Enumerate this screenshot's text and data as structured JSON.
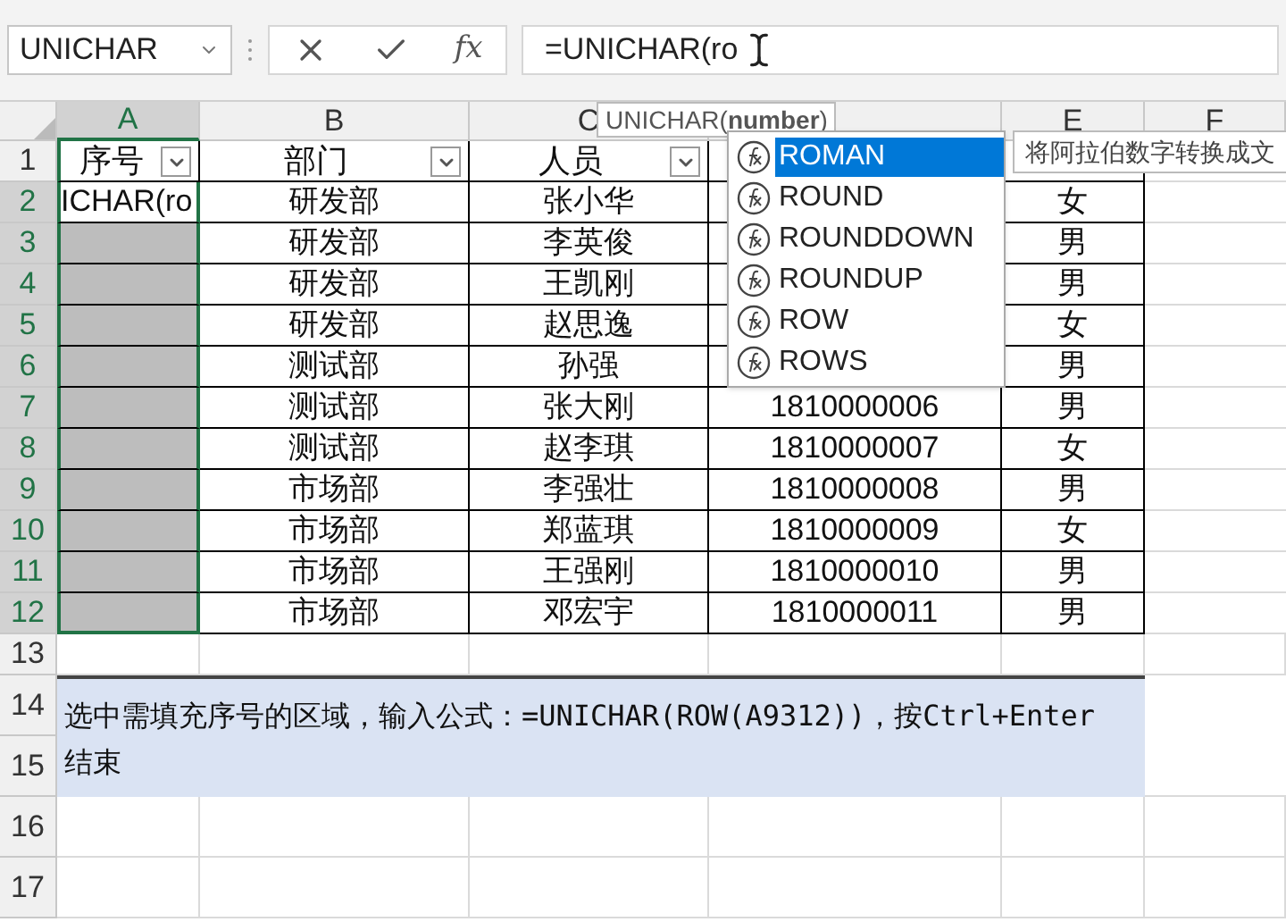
{
  "name_box": {
    "value": "UNICHAR"
  },
  "formula_bar": {
    "fx_label": "fx",
    "value": "=UNICHAR(ro"
  },
  "columns": [
    {
      "label": "A",
      "selected": true
    },
    {
      "label": "B",
      "selected": false
    },
    {
      "label": "C",
      "selected": false
    },
    {
      "selected": false
    },
    {
      "label": "E",
      "selected": false
    },
    {
      "label": "F",
      "selected": false
    }
  ],
  "rows": [
    {
      "kind": "header",
      "number": "1",
      "selected": false,
      "cells": [
        {
          "text": "序号",
          "filter": true
        },
        {
          "text": "部门",
          "filter": true
        },
        {
          "text": "人员",
          "filter": true
        }
      ]
    },
    {
      "kind": "data",
      "number": "2",
      "selected": true,
      "a": "ICHAR(ro",
      "dept": "研发部",
      "person": "张小华",
      "gender": "女"
    },
    {
      "kind": "data",
      "number": "3",
      "selected": true,
      "dept": "研发部",
      "person": "李英俊",
      "gender": "男"
    },
    {
      "kind": "data",
      "number": "4",
      "selected": true,
      "dept": "研发部",
      "person": "王凯刚",
      "gender": "男"
    },
    {
      "kind": "data",
      "number": "5",
      "selected": true,
      "dept": "研发部",
      "person": "赵思逸",
      "gender": "女"
    },
    {
      "kind": "data",
      "number": "6",
      "selected": true,
      "dept": "测试部",
      "person": "孙强",
      "gender": "男"
    },
    {
      "kind": "data",
      "number": "7",
      "selected": true,
      "dept": "测试部",
      "person": "张大刚",
      "phone": "1810000006",
      "gender": "男"
    },
    {
      "kind": "data",
      "number": "8",
      "selected": true,
      "dept": "测试部",
      "person": "赵李琪",
      "phone": "1810000007",
      "gender": "女"
    },
    {
      "kind": "data",
      "number": "9",
      "selected": true,
      "dept": "市场部",
      "person": "李强壮",
      "phone": "1810000008",
      "gender": "男"
    },
    {
      "kind": "data",
      "number": "10",
      "selected": true,
      "dept": "市场部",
      "person": "郑蓝琪",
      "phone": "1810000009",
      "gender": "女"
    },
    {
      "kind": "data",
      "number": "11",
      "selected": true,
      "dept": "市场部",
      "person": "王强刚",
      "phone": "1810000010",
      "gender": "男"
    },
    {
      "kind": "data",
      "number": "12",
      "selected": true,
      "dept": "市场部",
      "person": "邓宏宇",
      "phone": "1810000011",
      "gender": "男"
    },
    {
      "kind": "empty",
      "number": "13",
      "selected": false
    },
    {
      "kind": "note",
      "numbers": [
        "14",
        "15"
      ],
      "selected": false,
      "text": "选中需填充序号的区域，输入公式：=UNICHAR(ROW(A9312))，按Ctrl+Enter结束"
    },
    {
      "kind": "empty",
      "number": "16",
      "selected": false
    },
    {
      "kind": "empty",
      "number": "17",
      "selected": false
    }
  ],
  "screen_tip": "UNICHAR(**number**)",
  "autocomplete": {
    "items": [
      {
        "label": "ROMAN",
        "selected": true
      },
      {
        "label": "ROUND",
        "selected": false
      },
      {
        "label": "ROUNDDOWN",
        "selected": false
      },
      {
        "label": "ROUNDUP",
        "selected": false
      },
      {
        "label": "ROW",
        "selected": false
      },
      {
        "label": "ROWS",
        "selected": false
      }
    ],
    "description": "将阿拉伯数字转换成文"
  }
}
